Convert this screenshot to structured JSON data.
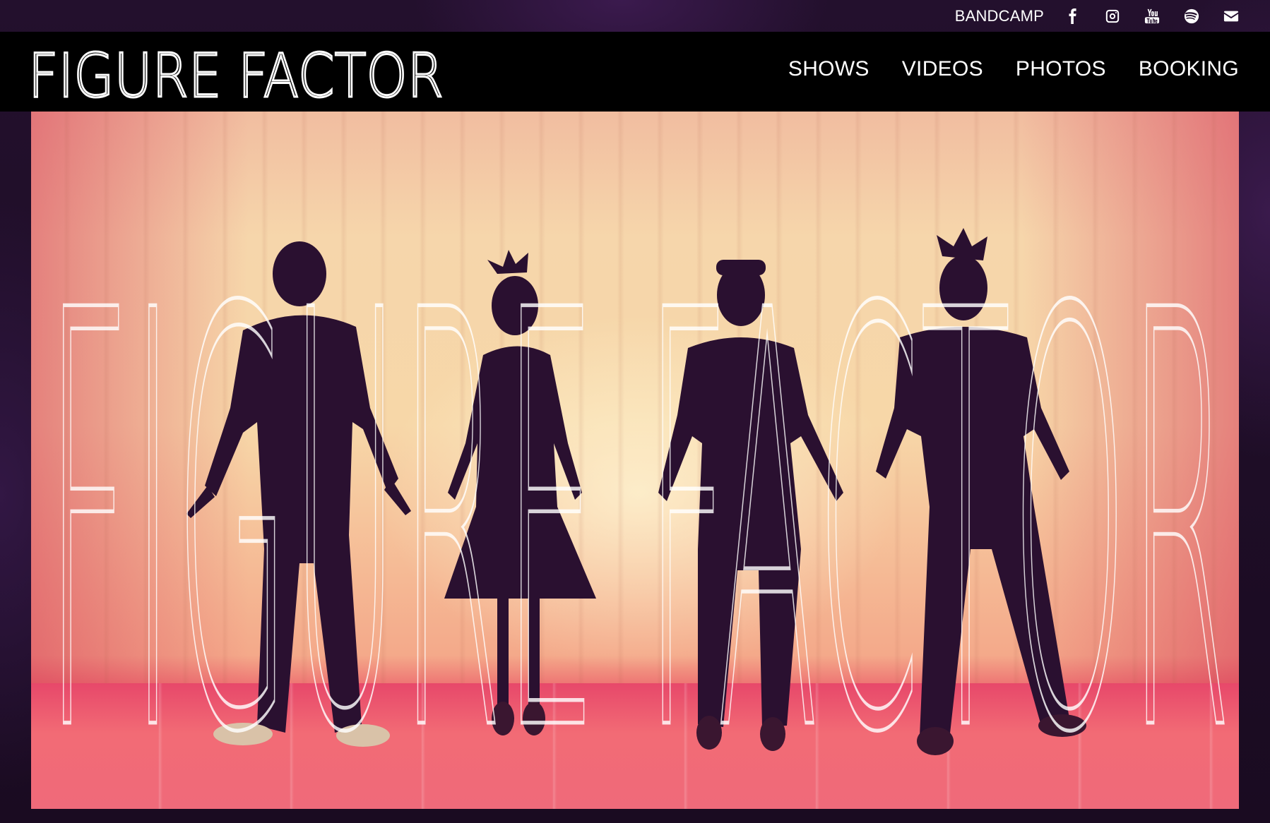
{
  "topbar": {
    "bandcamp_label": "BANDCAMP",
    "social_icons": [
      "facebook-icon",
      "instagram-icon",
      "youtube-icon",
      "spotify-icon",
      "envelope-icon"
    ]
  },
  "logo": {
    "text": "FIGURE FACTOR"
  },
  "nav": {
    "items": [
      {
        "label": "SHOWS"
      },
      {
        "label": "VIDEOS"
      },
      {
        "label": "PHOTOS"
      },
      {
        "label": "BOOKING"
      }
    ]
  },
  "hero": {
    "overlay_text": "FIGURE FACTOR"
  },
  "colors": {
    "navbar_bg": "#000000",
    "page_bg": "#1b0c22",
    "text": "#ffffff",
    "hero_warm": "#f7d7a8",
    "hero_pink": "#e8455e"
  }
}
